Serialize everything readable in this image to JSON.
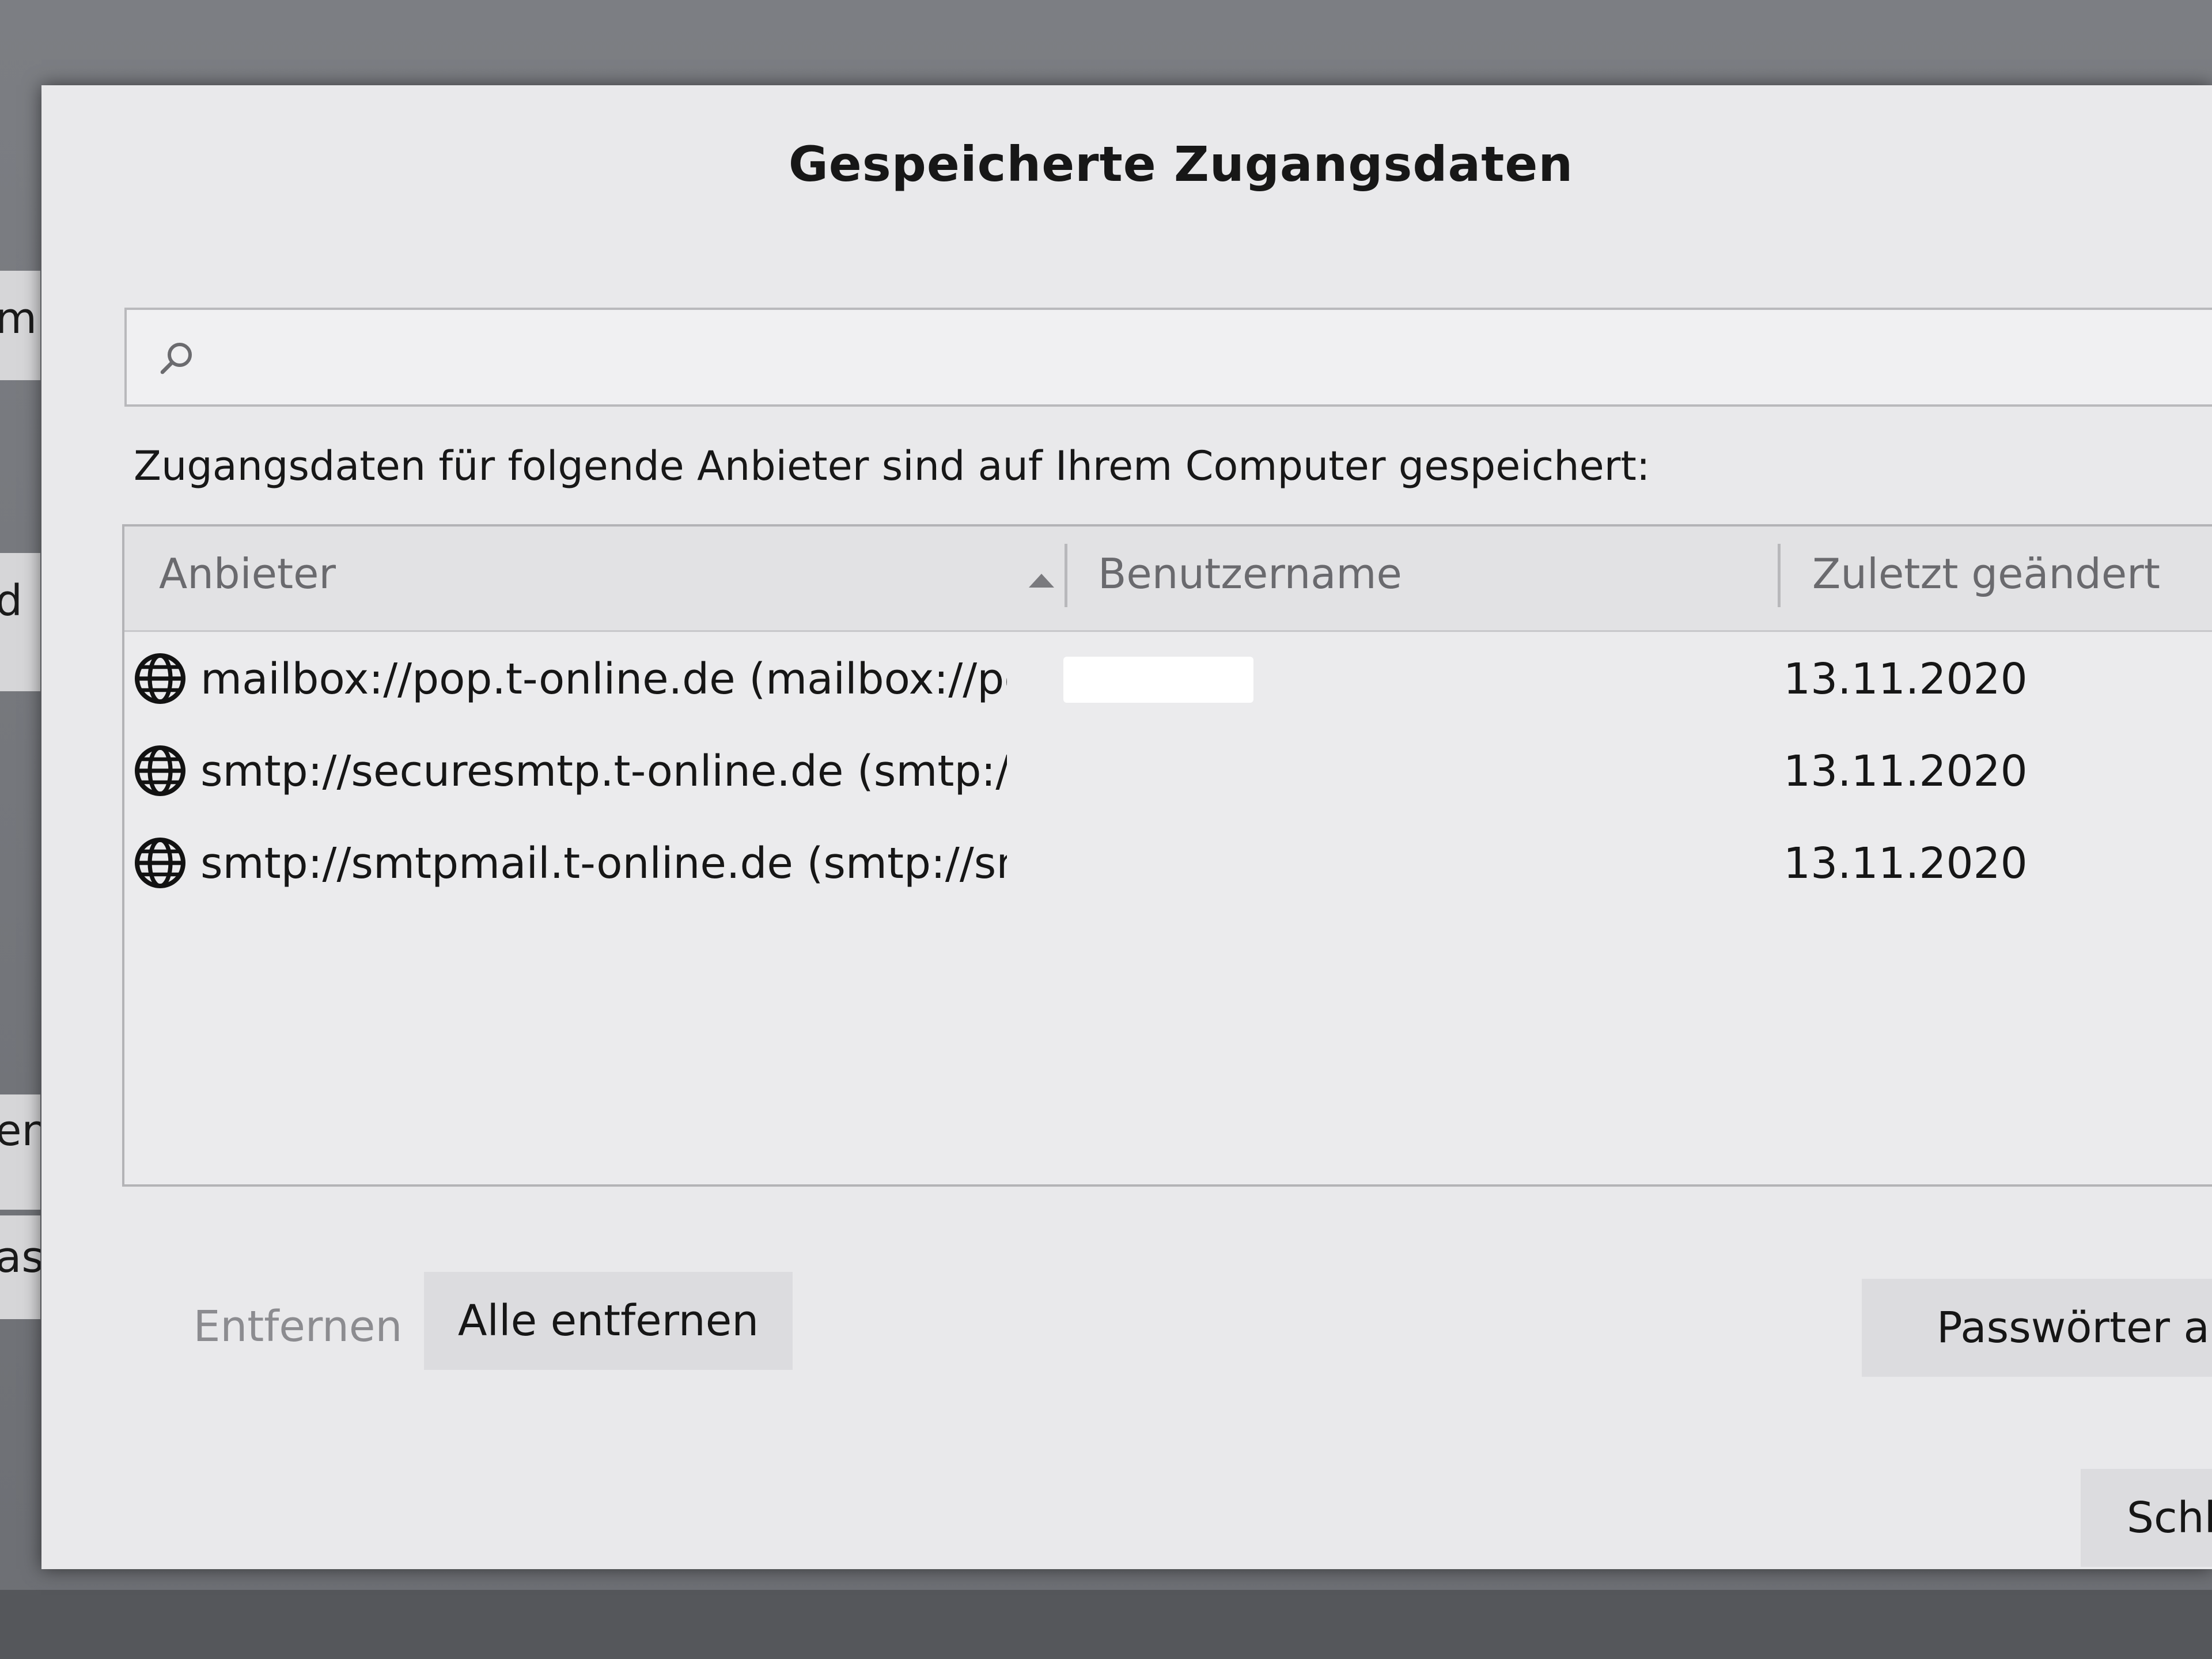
{
  "background_window": {
    "fragments": [
      "ml",
      "d",
      "en",
      "as"
    ]
  },
  "dialog": {
    "title": "Gespeicherte Zugangsdaten",
    "search": {
      "icon": "search-icon",
      "value": "",
      "placeholder": ""
    },
    "description": "Zugangsdaten für folgende Anbieter sind auf Ihrem Computer gespeichert:",
    "columns": {
      "provider": "Anbieter",
      "username": "Benutzername",
      "last_changed": "Zuletzt geändert",
      "sort_indicator": "ascending"
    },
    "rows": [
      {
        "icon": "globe-icon",
        "provider": "mailbox://pop.t-online.de (mailbox://po...",
        "username": "",
        "last_changed": "13.11.2020"
      },
      {
        "icon": "globe-icon",
        "provider": "smtp://securesmtp.t-online.de (smtp://s...",
        "username": "",
        "last_changed": "13.11.2020"
      },
      {
        "icon": "globe-icon",
        "provider": "smtp://smtpmail.t-online.de (smtp://smt...",
        "username": "",
        "last_changed": "13.11.2020"
      }
    ],
    "buttons": {
      "remove": "Entfernen",
      "remove_all": "Alle entfernen",
      "show_passwords": "Passwörter anzei",
      "close": "Schließ"
    }
  }
}
